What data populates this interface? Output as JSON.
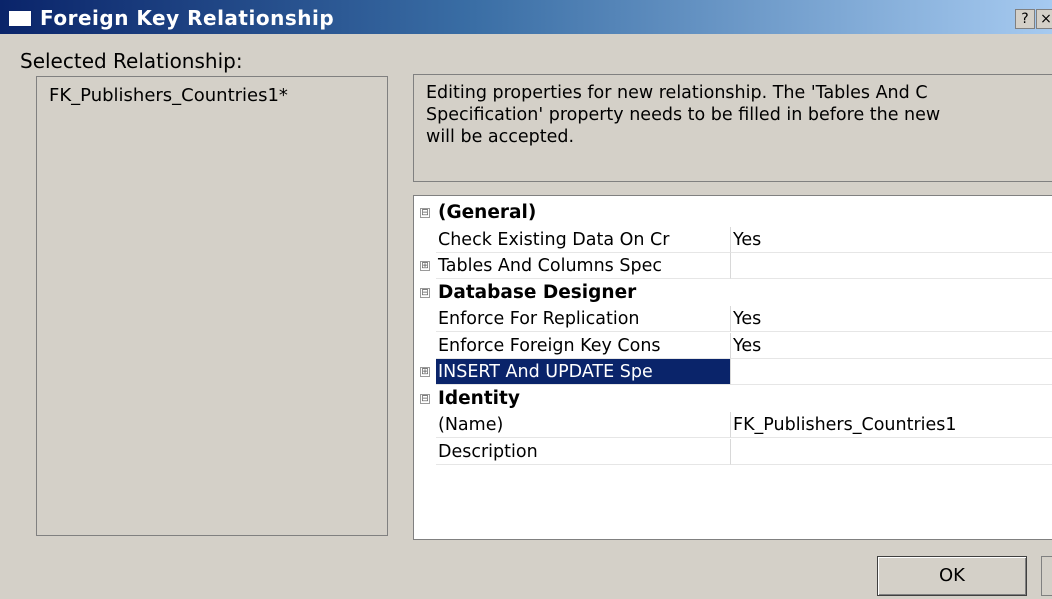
{
  "window": {
    "title": "Foreign Key Relationship",
    "help_label": "?",
    "close_label": "×",
    "icon": "window-icon"
  },
  "left": {
    "label": "Selected Relationship:",
    "items": [
      "FK_Publishers_Countries1*"
    ]
  },
  "description": {
    "lines": [
      "Editing properties for new relationship.  The 'Tables And C",
      "Specification' property needs to be filled in before the new",
      "will be accepted."
    ]
  },
  "grid": {
    "rows": [
      {
        "type": "category",
        "label": "(General)",
        "expander": "⊟"
      },
      {
        "type": "prop",
        "name": "Check Existing Data On Cr",
        "value": "Yes"
      },
      {
        "type": "prop",
        "name": "Tables And Columns Spec",
        "value": "",
        "expander": "⊞"
      },
      {
        "type": "category",
        "label": "Database Designer",
        "expander": "⊟"
      },
      {
        "type": "prop",
        "name": "Enforce For Replication",
        "value": "Yes"
      },
      {
        "type": "prop",
        "name": "Enforce Foreign Key Cons",
        "value": "Yes"
      },
      {
        "type": "prop",
        "name": "INSERT And UPDATE Spe",
        "value": "",
        "expander": "⊞",
        "selected": true
      },
      {
        "type": "category",
        "label": "Identity",
        "expander": "⊟"
      },
      {
        "type": "prop",
        "name": "(Name)",
        "value": "FK_Publishers_Countries1"
      },
      {
        "type": "prop",
        "name": "Description",
        "value": ""
      }
    ]
  },
  "buttons": {
    "ok_label": "OK"
  },
  "colors": {
    "title_start": "#0a246a",
    "title_end": "#a6caf0",
    "selection": "#0a246a",
    "dialog_bg": "#d4d0c8"
  }
}
